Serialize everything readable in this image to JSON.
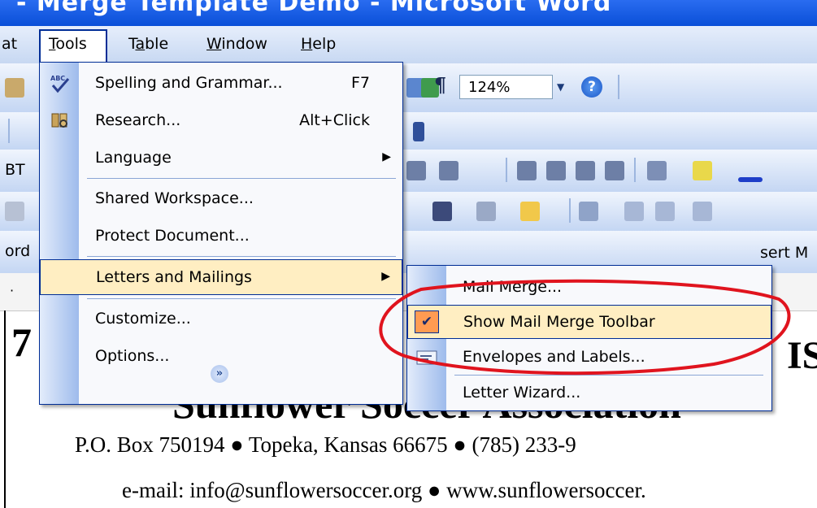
{
  "title_bar": {
    "text": "- Merge Template Demo - Microsoft Word"
  },
  "menubar": {
    "items": [
      {
        "label": "at"
      },
      {
        "label": "Tools",
        "accel": "T",
        "rest": "ools"
      },
      {
        "label": "Table",
        "pre": "T",
        "accel": "a",
        "rest": "ble"
      },
      {
        "label": "Window",
        "accel": "W",
        "rest": "indow"
      },
      {
        "label": "Help",
        "accel": "H",
        "rest": "elp"
      }
    ]
  },
  "toolbars": {
    "zoom": "124%",
    "pilcrow": "¶",
    "help": "?",
    "font_fragment": "BT",
    "word_fragment": "ord",
    "insert_merge_fragment": "sert M",
    "ruler_mark": "·"
  },
  "tools_menu": {
    "items": [
      {
        "label": "Spelling and Grammar...",
        "shortcut": "F7",
        "icon": "spelling-abc-check-icon"
      },
      {
        "label": "Research...",
        "shortcut": "Alt+Click",
        "icon": "research-book-icon"
      },
      {
        "label": "Language",
        "submenu": true
      },
      {
        "label": "Shared Workspace..."
      },
      {
        "label": "Protect Document..."
      },
      {
        "label": "Letters and Mailings",
        "submenu": true,
        "highlighted": true
      },
      {
        "label": "Customize..."
      },
      {
        "label": "Options..."
      }
    ],
    "more_glyph": "»"
  },
  "submenu": {
    "items": [
      {
        "label": "Mail Merge..."
      },
      {
        "label": "Show Mail Merge Toolbar",
        "checked": true,
        "highlighted": true
      },
      {
        "label": "Envelopes and Labels...",
        "icon": "envelope-labels-icon"
      },
      {
        "label": "Letter Wizard..."
      }
    ],
    "check_glyph": "✔"
  },
  "document": {
    "heading_fragment": "7",
    "heading_right_fragment": "IS",
    "org_name": "Sunflower Soccer Association",
    "address": "P.O. Box 750194  ●  Topeka, Kansas  66675   ●   (785) 233-9",
    "contact": "e-mail:  info@sunflowersoccer.org  ●   www.sunflowersoccer."
  },
  "colors": {
    "highlight": "#ffeec2",
    "menu_border": "#002d96",
    "annotation": "#e0141e",
    "check_bg": "#ff9b52"
  }
}
